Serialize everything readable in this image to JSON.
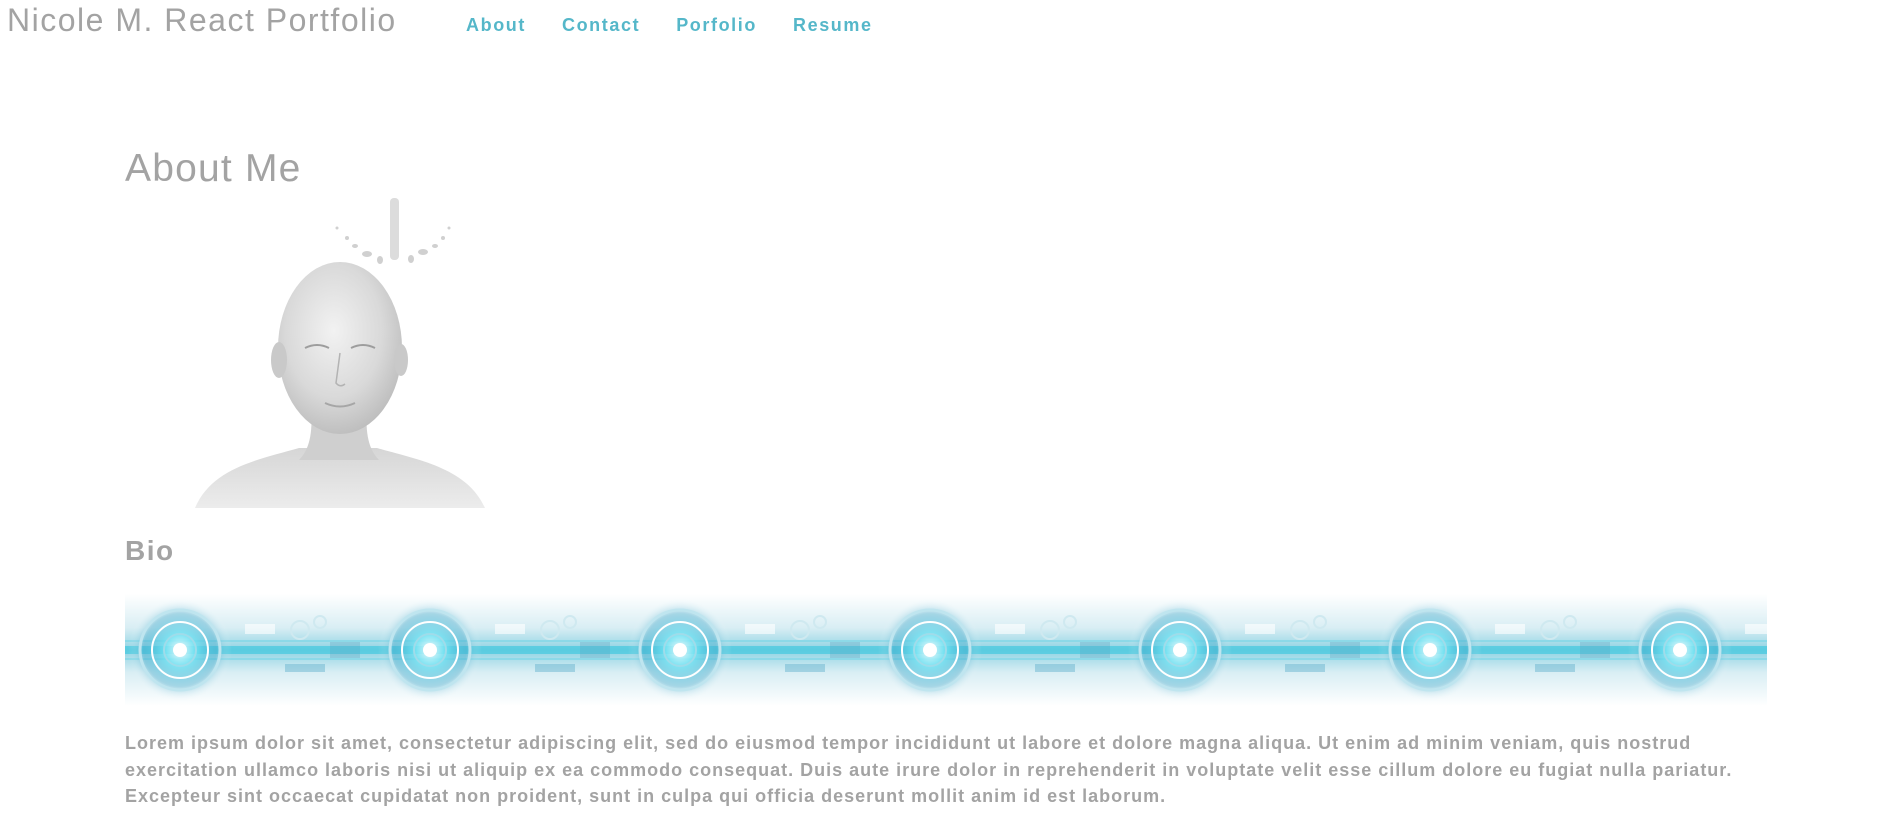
{
  "header": {
    "brand": "Nicole M. React Portfolio",
    "nav": [
      {
        "label": "About"
      },
      {
        "label": "Contact"
      },
      {
        "label": "Porfolio"
      },
      {
        "label": "Resume"
      }
    ]
  },
  "about": {
    "title": "About Me",
    "portrait_alt": "white sculpted head with splash",
    "bio_title": "Bio",
    "bio_text": "Lorem ipsum dolor sit amet, consectetur adipiscing elit, sed do eiusmod tempor incididunt ut labore et dolore magna aliqua. Ut enim ad minim veniam, quis nostrud exercitation ullamco laboris nisi ut aliquip ex ea commodo consequat. Duis aute irure dolor in reprehenderit in voluptate velit esse cillum dolore eu fugiat nulla pariatur. Excepteur sint occaecat cupidatat non proident, sunt in culpa qui officia deserunt mollit anim id est laborum."
  },
  "colors": {
    "nav_accent": "#55b7c9",
    "text_gray": "#a3a3a3",
    "banner_cyan": "#36c6dd"
  }
}
